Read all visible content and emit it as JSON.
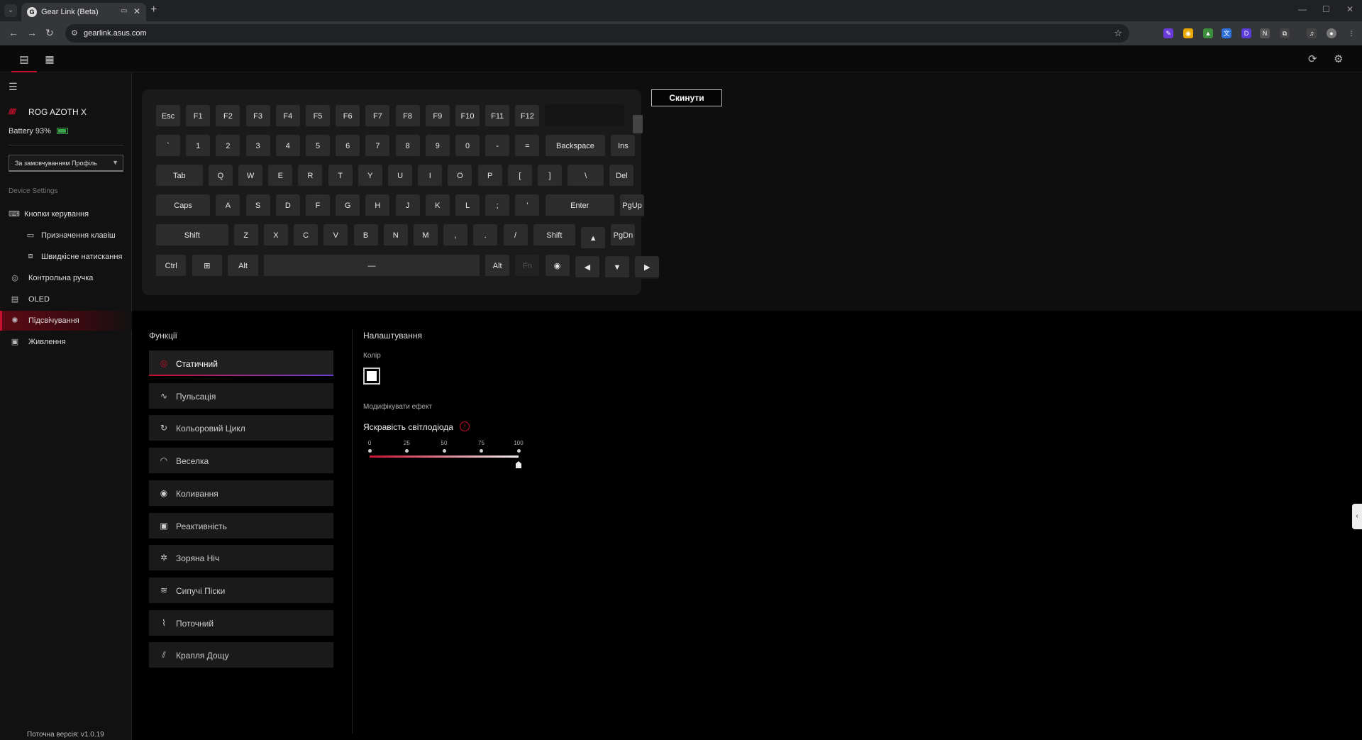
{
  "browser": {
    "tab_title": "Gear Link (Beta)",
    "url": "gearlink.asus.com",
    "new_tab": "+",
    "close_tab": "✕",
    "win_min": "—",
    "win_max": "☐",
    "win_close": "✕"
  },
  "sidebar": {
    "device_name": "ROG AZOTH X",
    "battery_text": "Battery 93%",
    "battery_level": 0.93,
    "profile": "За замовчуванням Профіль",
    "section_label": "Device Settings",
    "items": [
      {
        "label": "Кнопки керування",
        "icon": "keyboard-icon"
      },
      {
        "label": "Призначення клавіш",
        "icon": "key-assign-icon"
      },
      {
        "label": "Швидкісне натискання",
        "icon": "rapid-trigger-icon"
      },
      {
        "label": "Контрольна ручка",
        "icon": "knob-icon"
      },
      {
        "label": "OLED",
        "icon": "oled-icon"
      },
      {
        "label": "Підсвічування",
        "icon": "lighting-icon"
      },
      {
        "label": "Живлення",
        "icon": "power-icon"
      }
    ],
    "version": "Поточна версія: v1.0.19"
  },
  "keyboard": {
    "reset_label": "Скинути",
    "rows": [
      [
        "Esc",
        "F1",
        "F2",
        "F3",
        "F4",
        "F5",
        "F6",
        "F7",
        "F8",
        "F9",
        "F10",
        "F11",
        "F12"
      ],
      [
        "`",
        "1",
        "2",
        "3",
        "4",
        "5",
        "6",
        "7",
        "8",
        "9",
        "0",
        "-",
        "=",
        "Backspace",
        "Ins"
      ],
      [
        "Tab",
        "Q",
        "W",
        "E",
        "R",
        "T",
        "Y",
        "U",
        "I",
        "O",
        "P",
        "[",
        "]",
        "\\",
        "Del"
      ],
      [
        "Caps",
        "A",
        "S",
        "D",
        "F",
        "G",
        "H",
        "J",
        "K",
        "L",
        ";",
        "'",
        "Enter",
        "PgUp"
      ],
      [
        "Shift",
        "Z",
        "X",
        "C",
        "V",
        "B",
        "N",
        "M",
        ",",
        ".",
        "/",
        "Shift",
        "▲",
        "PgDn"
      ],
      [
        "Ctrl",
        "⊞",
        "Alt",
        "—",
        "Alt",
        "Fn",
        "◉",
        "◀",
        "▼",
        "▶"
      ]
    ]
  },
  "functions": {
    "title": "Функції",
    "effects": [
      {
        "label": "Статичний",
        "icon": "static-icon",
        "glyph": "◎",
        "active": true
      },
      {
        "label": "Пульсація",
        "icon": "pulse-icon",
        "glyph": "∿"
      },
      {
        "label": "Кольоровий Цикл",
        "icon": "color-cycle-icon",
        "glyph": "↻"
      },
      {
        "label": "Веселка",
        "icon": "rainbow-icon",
        "glyph": "◠"
      },
      {
        "label": "Коливання",
        "icon": "wave-icon",
        "glyph": "◉"
      },
      {
        "label": "Реактивність",
        "icon": "reactive-icon",
        "glyph": "▣"
      },
      {
        "label": "Зоряна Ніч",
        "icon": "starry-night-icon",
        "glyph": "✲"
      },
      {
        "label": "Сипучі Піски",
        "icon": "quicksand-icon",
        "glyph": "≋"
      },
      {
        "label": "Поточний",
        "icon": "current-icon",
        "glyph": "⌇"
      },
      {
        "label": "Крапля Дощу",
        "icon": "raindrop-icon",
        "glyph": "⫽"
      }
    ]
  },
  "settings": {
    "title": "Налаштування",
    "color_label": "Колір",
    "color_value": "#ffffff",
    "modify_label": "Модифікувати ефект",
    "brightness_label": "Яскравість світлодіода",
    "brightness_ticks": [
      "0",
      "25",
      "50",
      "75",
      "100"
    ],
    "brightness_value": 100,
    "accent_color": "#c8102e"
  }
}
